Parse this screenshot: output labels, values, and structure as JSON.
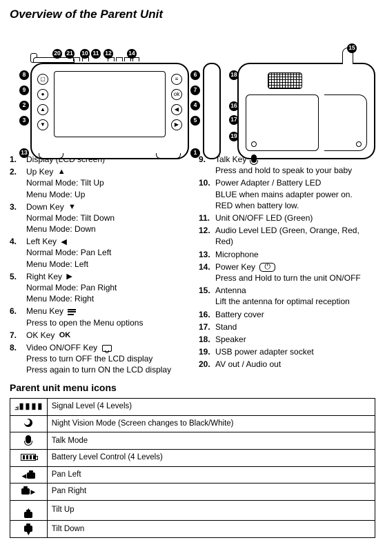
{
  "title": "Overview of the Parent Unit",
  "subtitle": "Parent unit menu icons",
  "features_left": [
    {
      "num": "1.",
      "name": "Display (LCD screen)",
      "sym": "",
      "desc": []
    },
    {
      "num": "2.",
      "name": "Up Key",
      "sym": "▲",
      "desc": [
        "Normal Mode: Tilt Up",
        "Menu Mode: Up"
      ]
    },
    {
      "num": "3.",
      "name": "Down Key",
      "sym": "▼",
      "desc": [
        "Normal Mode: Tilt Down",
        "Menu Mode: Down"
      ]
    },
    {
      "num": "4.",
      "name": "Left Key",
      "sym": "◀",
      "desc": [
        "Normal Mode: Pan Left",
        "Menu Mode: Left"
      ]
    },
    {
      "num": "5.",
      "name": "Right Key",
      "sym": "▶",
      "desc": [
        "Normal Mode: Pan Right",
        "Menu Mode: Right"
      ]
    },
    {
      "num": "6.",
      "name": "Menu Key",
      "sym": "menu",
      "desc": [
        "Press to open the Menu options"
      ]
    },
    {
      "num": "7.",
      "name": "OK Key",
      "sym": "OK",
      "desc": []
    },
    {
      "num": "8.",
      "name": "Video ON/OFF Key",
      "sym": "vid",
      "desc": [
        "Press to turn OFF the LCD display",
        "Press again to turn ON the LCD display"
      ]
    }
  ],
  "features_right": [
    {
      "num": "9.",
      "name": "Talk Key",
      "sym": "mic",
      "desc": [
        "Press and hold to speak to your baby"
      ]
    },
    {
      "num": "10.",
      "name": "Power Adapter / Battery LED",
      "sym": "",
      "desc": [
        "BLUE when mains adapter power on.",
        "RED when battery low."
      ]
    },
    {
      "num": "11.",
      "name": "Unit ON/OFF LED (Green)",
      "sym": "",
      "desc": []
    },
    {
      "num": "12.",
      "name": "Audio Level LED (Green, Orange, Red, Red)",
      "sym": "",
      "desc": []
    },
    {
      "num": "13.",
      "name": "Microphone",
      "sym": "",
      "desc": []
    },
    {
      "num": "14.",
      "name": "Power Key",
      "sym": "power",
      "desc": [
        "Press and Hold to turn the unit ON/OFF"
      ]
    },
    {
      "num": "15.",
      "name": "Antenna",
      "sym": "",
      "desc": [
        "Lift the antenna for optimal reception"
      ]
    },
    {
      "num": "16.",
      "name": "Battery cover",
      "sym": "",
      "desc": []
    },
    {
      "num": "17.",
      "name": "Stand",
      "sym": "",
      "desc": []
    },
    {
      "num": "18.",
      "name": "Speaker",
      "sym": "",
      "desc": []
    },
    {
      "num": "19.",
      "name": "USB power adapter socket",
      "sym": "",
      "desc": []
    },
    {
      "num": "20.",
      "name": "AV out / Audio out",
      "sym": "",
      "desc": []
    }
  ],
  "icons_table": [
    {
      "label": "Signal Level (4 Levels)",
      "icon": "signal"
    },
    {
      "label": "Night Vision Mode (Screen changes to Black/White)",
      "icon": "moon"
    },
    {
      "label": "Talk Mode",
      "icon": "mic"
    },
    {
      "label": "Battery Level Control (4 Levels)",
      "icon": "batt"
    },
    {
      "label": "Pan Left",
      "icon": "panleft"
    },
    {
      "label": "Pan Right",
      "icon": "panright"
    },
    {
      "label": "Tilt Up",
      "icon": "tiltup"
    },
    {
      "label": "Tilt Down",
      "icon": "tiltdown"
    }
  ],
  "callouts": [
    "1",
    "2",
    "3",
    "4",
    "5",
    "6",
    "7",
    "8",
    "9",
    "10",
    "11",
    "12",
    "13",
    "14",
    "15",
    "16",
    "17",
    "18",
    "19",
    "20",
    "21"
  ]
}
